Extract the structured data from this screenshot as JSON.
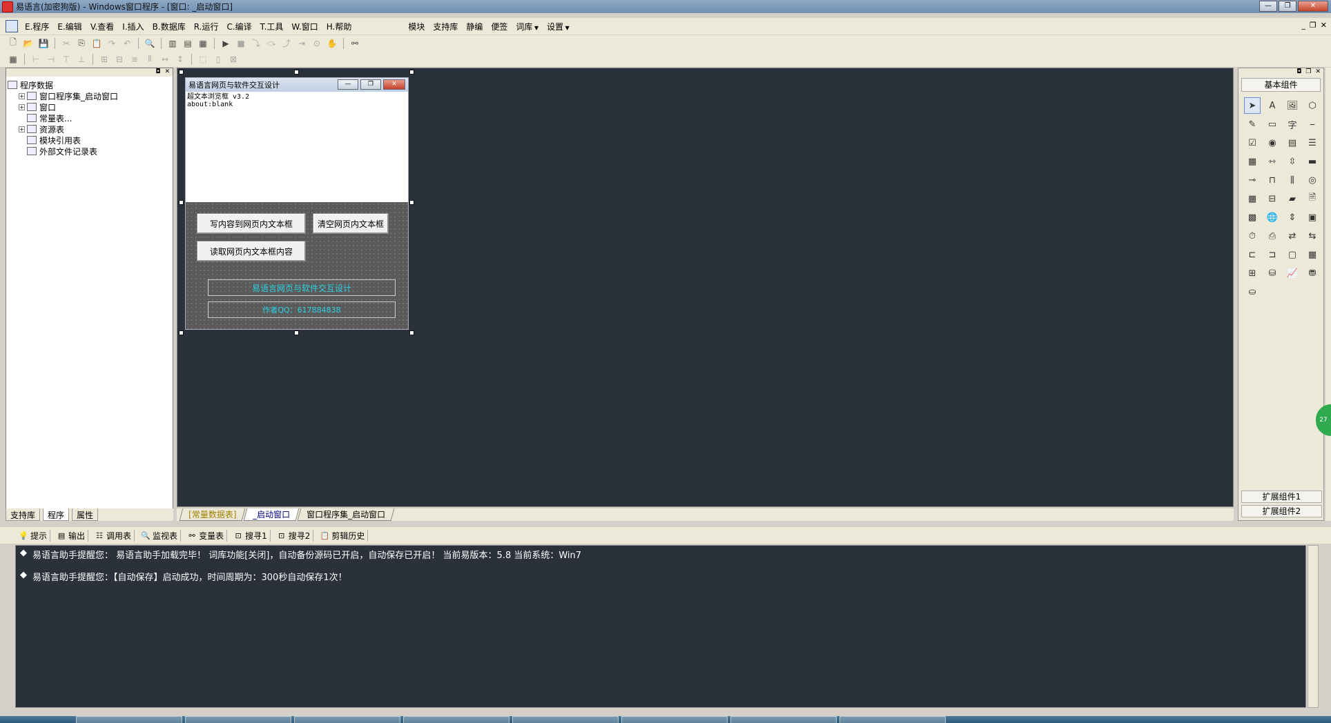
{
  "window": {
    "title": "易语言(加密狗版) - Windows窗口程序 - [窗口: _启动窗口]",
    "controls": [
      "—",
      "❐",
      "✕"
    ]
  },
  "menubar": {
    "items": [
      "E.程序",
      "E.编辑",
      "V.查看",
      "I.插入",
      "B.数据库",
      "R.运行",
      "C.编译",
      "T.工具",
      "W.窗口",
      "H.帮助"
    ],
    "extras": [
      "模块",
      "支持库",
      "静编",
      "便签",
      "词库",
      "设置"
    ]
  },
  "left_panel": {
    "tree": [
      {
        "label": "程序数据",
        "level": 0,
        "expand": ""
      },
      {
        "label": "窗口程序集_启动窗口",
        "level": 1,
        "expand": "+"
      },
      {
        "label": "窗口",
        "level": 1,
        "expand": "+"
      },
      {
        "label": "常量表...",
        "level": 1,
        "expand": ""
      },
      {
        "label": "资源表",
        "level": 1,
        "expand": "+"
      },
      {
        "label": "模块引用表",
        "level": 1,
        "expand": ""
      },
      {
        "label": "外部文件记录表",
        "level": 1,
        "expand": ""
      }
    ],
    "tabs": [
      "支持库",
      "程序",
      "属性"
    ]
  },
  "doc_tabs": [
    "[常量数据表]",
    "_启动窗口",
    "窗口程序集_启动窗口"
  ],
  "form": {
    "title": "易语言网页与软件交互设计",
    "browser_lines": [
      "超文本浏览框 v3.2",
      "about:blank"
    ],
    "btn_write": "写内容到网页内文本框",
    "btn_clear": "清空网页内文本框",
    "btn_read": "读取网页内文本框内容",
    "label1": "易语言网页与软件交互设计",
    "label2": "作者QQ：617884838"
  },
  "right_panel": {
    "title": "基本组件",
    "ext1": "扩展组件1",
    "ext2": "扩展组件2",
    "green_tab": "27"
  },
  "output_tabs": [
    "提示",
    "输出",
    "调用表",
    "监视表",
    "变量表",
    "搜寻1",
    "搜寻2",
    "剪辑历史"
  ],
  "output_lines": [
    "易语言助手提醒您：  易语言助手加载完毕！ 词库功能[关闭]，自动备份源码已开启，自动保存已开启！ 当前易版本：5.8  当前系统：Win7",
    "易语言助手提醒您：【自动保存】启动成功，时间周期为：300秒自动保存1次！"
  ]
}
